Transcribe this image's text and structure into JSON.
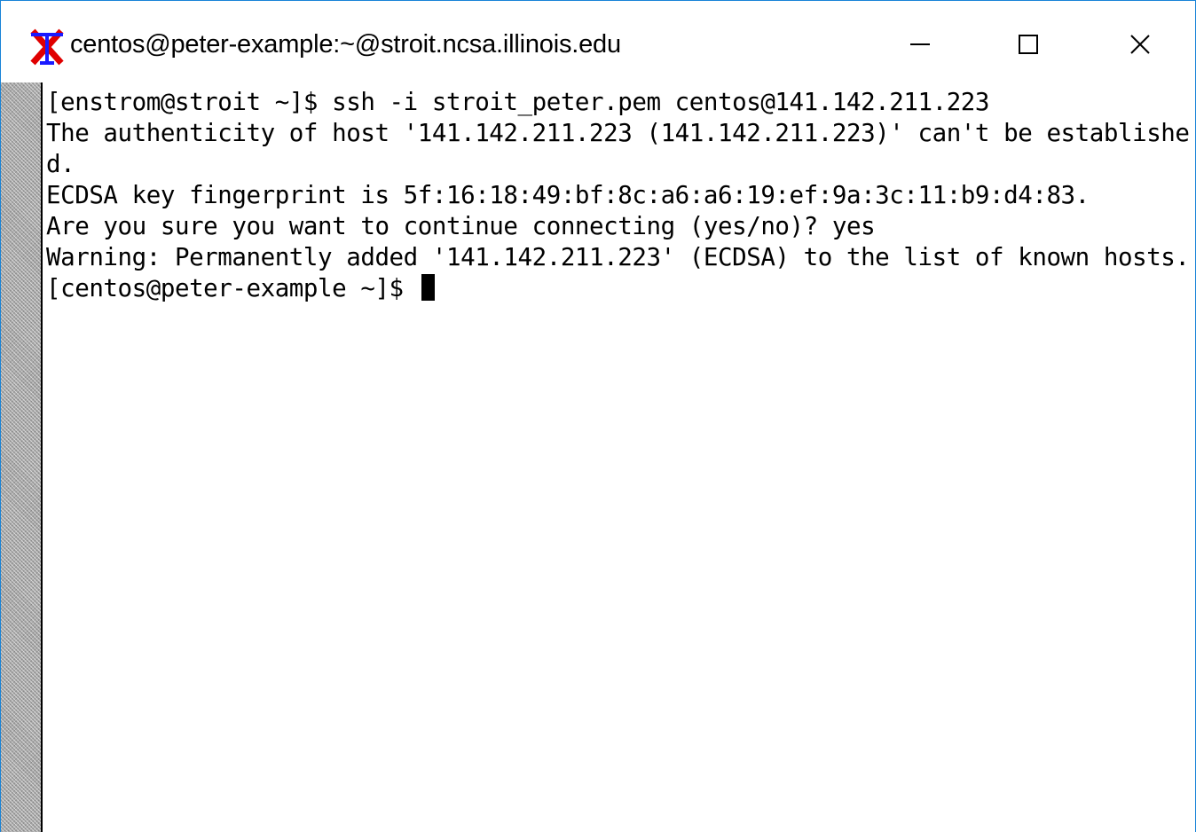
{
  "window": {
    "title": "centos@peter-example:~@stroit.ncsa.illinois.edu",
    "icon": "xterm-x-icon",
    "controls": {
      "minimize": "minimize-icon",
      "maximize": "maximize-icon",
      "close": "close-icon"
    }
  },
  "terminal": {
    "lines": [
      "[enstrom@stroit ~]$ ssh -i stroit_peter.pem centos@141.142.211.223",
      "The authenticity of host '141.142.211.223 (141.142.211.223)' can't be establishe",
      "d.",
      "ECDSA key fingerprint is 5f:16:18:49:bf:8c:a6:a6:19:ef:9a:3c:11:b9:d4:83.",
      "Are you sure you want to continue connecting (yes/no)? yes",
      "Warning: Permanently added '141.142.211.223' (ECDSA) to the list of known hosts.",
      "[centos@peter-example ~]$ "
    ]
  },
  "colors": {
    "window_border": "#1883d7",
    "icon_blue": "#1a1aff",
    "icon_red": "#e00000"
  }
}
